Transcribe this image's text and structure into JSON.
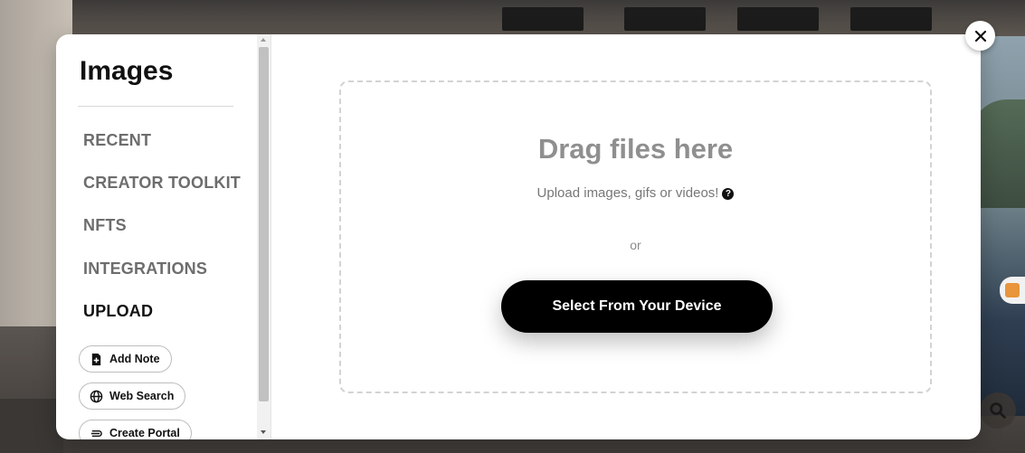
{
  "modal": {
    "title": "Images",
    "nav": [
      {
        "label": "RECENT",
        "active": false
      },
      {
        "label": "CREATOR TOOLKIT",
        "active": false
      },
      {
        "label": "NFTS",
        "active": false
      },
      {
        "label": "INTEGRATIONS",
        "active": false
      },
      {
        "label": "UPLOAD",
        "active": true
      }
    ],
    "actions": [
      {
        "label": "Add Note",
        "icon": "note-add-icon"
      },
      {
        "label": "Web Search",
        "icon": "globe-icon"
      },
      {
        "label": "Create Portal",
        "icon": "portal-icon"
      }
    ],
    "upload": {
      "heading": "Drag files here",
      "subtext": "Upload images, gifs or videos!",
      "help_glyph": "?",
      "or_text": "or",
      "button_label": "Select From Your Device"
    }
  },
  "colors": {
    "accent_button": "#000000",
    "active_nav": "#111111",
    "inactive_nav": "#6d6d6d"
  }
}
